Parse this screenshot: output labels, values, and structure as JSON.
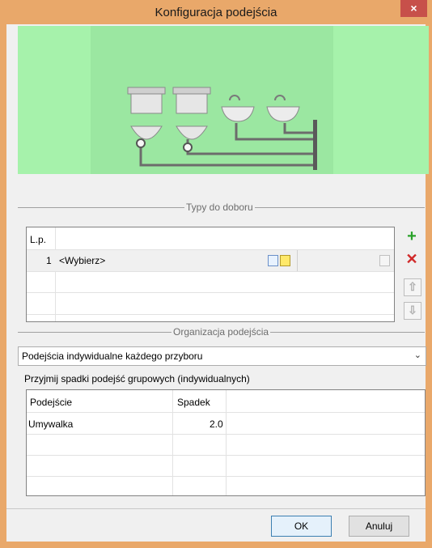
{
  "window": {
    "title": "Konfiguracja podejścia",
    "close_label": "×"
  },
  "preview": {
    "icon": "fixtures-schematic"
  },
  "types_section": {
    "title": "Typy do doboru",
    "header_col1": "L.p.",
    "rows": [
      {
        "lp": "1",
        "value": "<Wybierz>"
      }
    ],
    "buttons": {
      "add": "+",
      "delete": "✕",
      "up": "⇧",
      "down": "⇩"
    }
  },
  "organization_section": {
    "title": "Organizacja podejścia",
    "combo_value": "Podejścia indywidualne każdego przyboru",
    "slopes_label": "Przyjmij spadki podejść grupowych (indywidualnych)",
    "columns": [
      "Podejście",
      "Spadek"
    ],
    "rows": [
      {
        "name": "Umywalka",
        "slope": "2.0"
      }
    ]
  },
  "buttons": {
    "ok": "OK",
    "cancel": "Anuluj"
  },
  "colors": {
    "preview_bg": "#a6f2ab",
    "add": "#2aa22a",
    "delete": "#d12a2a"
  }
}
